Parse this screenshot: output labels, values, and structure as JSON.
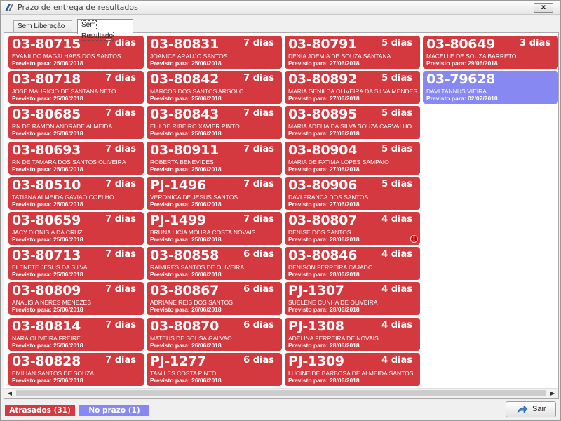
{
  "window": {
    "title": "Prazo de entrega de resultados",
    "close_label": "x"
  },
  "tabs": [
    {
      "label": "Sem Liberação",
      "active": false
    },
    {
      "label": "Sem Resultado",
      "active": true
    }
  ],
  "colors": {
    "late": "#d4393f",
    "ok": "#8888f3"
  },
  "due_prefix": "Previsto para:",
  "columns": [
    [
      {
        "code": "03-80715",
        "days": "7 dias",
        "name": "EVANILDO MAGALHAES DOS SANTOS",
        "due": "25/06/2018",
        "status": "late"
      },
      {
        "code": "03-80718",
        "days": "7 dias",
        "name": "JOSE MAURICIO DE SANTANA NETO",
        "due": "25/06/2018",
        "status": "late"
      },
      {
        "code": "03-80685",
        "days": "7 dias",
        "name": "RN DE RAMON ANDRADE ALMEIDA",
        "due": "25/06/2018",
        "status": "late"
      },
      {
        "code": "03-80693",
        "days": "7 dias",
        "name": "RN DE TAMARA DOS SANTOS OLIVEIRA",
        "due": "25/06/2018",
        "status": "late"
      },
      {
        "code": "03-80510",
        "days": "7 dias",
        "name": "TATIANA ALMEIDA GAVIAO COELHO",
        "due": "25/06/2018",
        "status": "late"
      },
      {
        "code": "03-80659",
        "days": "7 dias",
        "name": "JACY DIONISIA DA CRUZ",
        "due": "25/06/2018",
        "status": "late"
      },
      {
        "code": "03-80713",
        "days": "7 dias",
        "name": "ELENETE JESUS DA SILVA",
        "due": "25/06/2018",
        "status": "late"
      },
      {
        "code": "03-80809",
        "days": "7 dias",
        "name": "ANALISIA NERES MENEZES",
        "due": "25/06/2018",
        "status": "late"
      },
      {
        "code": "03-80814",
        "days": "7 dias",
        "name": "NARA OLIVEIRA FREIRE",
        "due": "25/06/2018",
        "status": "late"
      },
      {
        "code": "03-80828",
        "days": "7 dias",
        "name": "EMILIAN SANTOS DE SOUZA",
        "due": "25/06/2018",
        "status": "late"
      }
    ],
    [
      {
        "code": "03-80831",
        "days": "7 dias",
        "name": "JOANICE ARAUJO SANTOS",
        "due": "25/06/2018",
        "status": "late"
      },
      {
        "code": "03-80842",
        "days": "7 dias",
        "name": "MARCOS DOS SANTOS ARGOLO",
        "due": "25/06/2018",
        "status": "late"
      },
      {
        "code": "03-80843",
        "days": "7 dias",
        "name": "ELILDE RIBEIRO XAVIER PINTO",
        "due": "25/06/2018",
        "status": "late"
      },
      {
        "code": "03-80911",
        "days": "7 dias",
        "name": "ROBERTA BENEVIDES",
        "due": "25/06/2018",
        "status": "late"
      },
      {
        "code": "PJ-1496",
        "days": "7 dias",
        "name": "VERONICA DE JESUS SANTOS",
        "due": "25/06/2018",
        "status": "late"
      },
      {
        "code": "PJ-1499",
        "days": "7 dias",
        "name": "BRUNA LICIA MOURA COSTA NOVAIS",
        "due": "25/06/2018",
        "status": "late"
      },
      {
        "code": "03-80858",
        "days": "6 dias",
        "name": "RAIMIRES SANTOS DE OLIVEIRA",
        "due": "26/06/2018",
        "status": "late"
      },
      {
        "code": "03-80867",
        "days": "6 dias",
        "name": "ADRIANE REIS DOS SANTOS",
        "due": "26/06/2018",
        "status": "late"
      },
      {
        "code": "03-80870",
        "days": "6 dias",
        "name": "MATEUS DE SOUSA GALVAO",
        "due": "26/06/2018",
        "status": "late"
      },
      {
        "code": "PJ-1277",
        "days": "6 dias",
        "name": "TAMILES COSTA PINTO",
        "due": "26/06/2018",
        "status": "late"
      }
    ],
    [
      {
        "code": "03-80791",
        "days": "5 dias",
        "name": "DENIA JOEMIA DE SOUZA SANTANA",
        "due": "27/06/2018",
        "status": "late"
      },
      {
        "code": "03-80892",
        "days": "5 dias",
        "name": "MARIA GENILDA OLIVEIRA DA SILVA MENDES",
        "due": "27/06/2018",
        "status": "late"
      },
      {
        "code": "03-80895",
        "days": "5 dias",
        "name": "MARIA ADELIA DA SILVA SOUZA CARVALHO",
        "due": "27/06/2018",
        "status": "late"
      },
      {
        "code": "03-80904",
        "days": "5 dias",
        "name": "MARIA DE FATIMA LOPES SAMPAIO",
        "due": "27/06/2018",
        "status": "late"
      },
      {
        "code": "03-80906",
        "days": "5 dias",
        "name": "DAVI FRANCA DOS SANTOS",
        "due": "27/06/2018",
        "status": "late"
      },
      {
        "code": "03-80807",
        "days": "4 dias",
        "name": "DENISE DOS SANTOS",
        "due": "28/06/2018",
        "status": "late",
        "alert": true
      },
      {
        "code": "03-80846",
        "days": "4 dias",
        "name": "DENISON FERREIRA CAJADO",
        "due": "28/06/2018",
        "status": "late"
      },
      {
        "code": "PJ-1307",
        "days": "4 dias",
        "name": "SUELENE CUNHA DE OLIVEIRA",
        "due": "28/06/2018",
        "status": "late"
      },
      {
        "code": "PJ-1308",
        "days": "4 dias",
        "name": "ADELINA FERREIRA DE NOVAIS",
        "due": "28/06/2018",
        "status": "late"
      },
      {
        "code": "PJ-1309",
        "days": "4 dias",
        "name": "LUCINEIDE BARBOSA DE ALMEIDA SANTOS",
        "due": "28/06/2018",
        "status": "late"
      }
    ],
    [
      {
        "code": "03-80649",
        "days": "3 dias",
        "name": "MACELLE DE SOUZA BARRETO",
        "due": "29/06/2018",
        "status": "late"
      },
      {
        "code": "03-79628",
        "days": "",
        "name": "DAVI TANNUS VIEIRA",
        "due": "02/07/2018",
        "status": "ok"
      }
    ]
  ],
  "legend": {
    "late_label": "Atrasados (31)",
    "ok_label": "No prazo (1)"
  },
  "footer": {
    "exit_label": "Sair"
  },
  "icons": {
    "app": "app-logo-icon",
    "alert": "exclamation-icon",
    "exit": "exit-arrow-icon"
  }
}
